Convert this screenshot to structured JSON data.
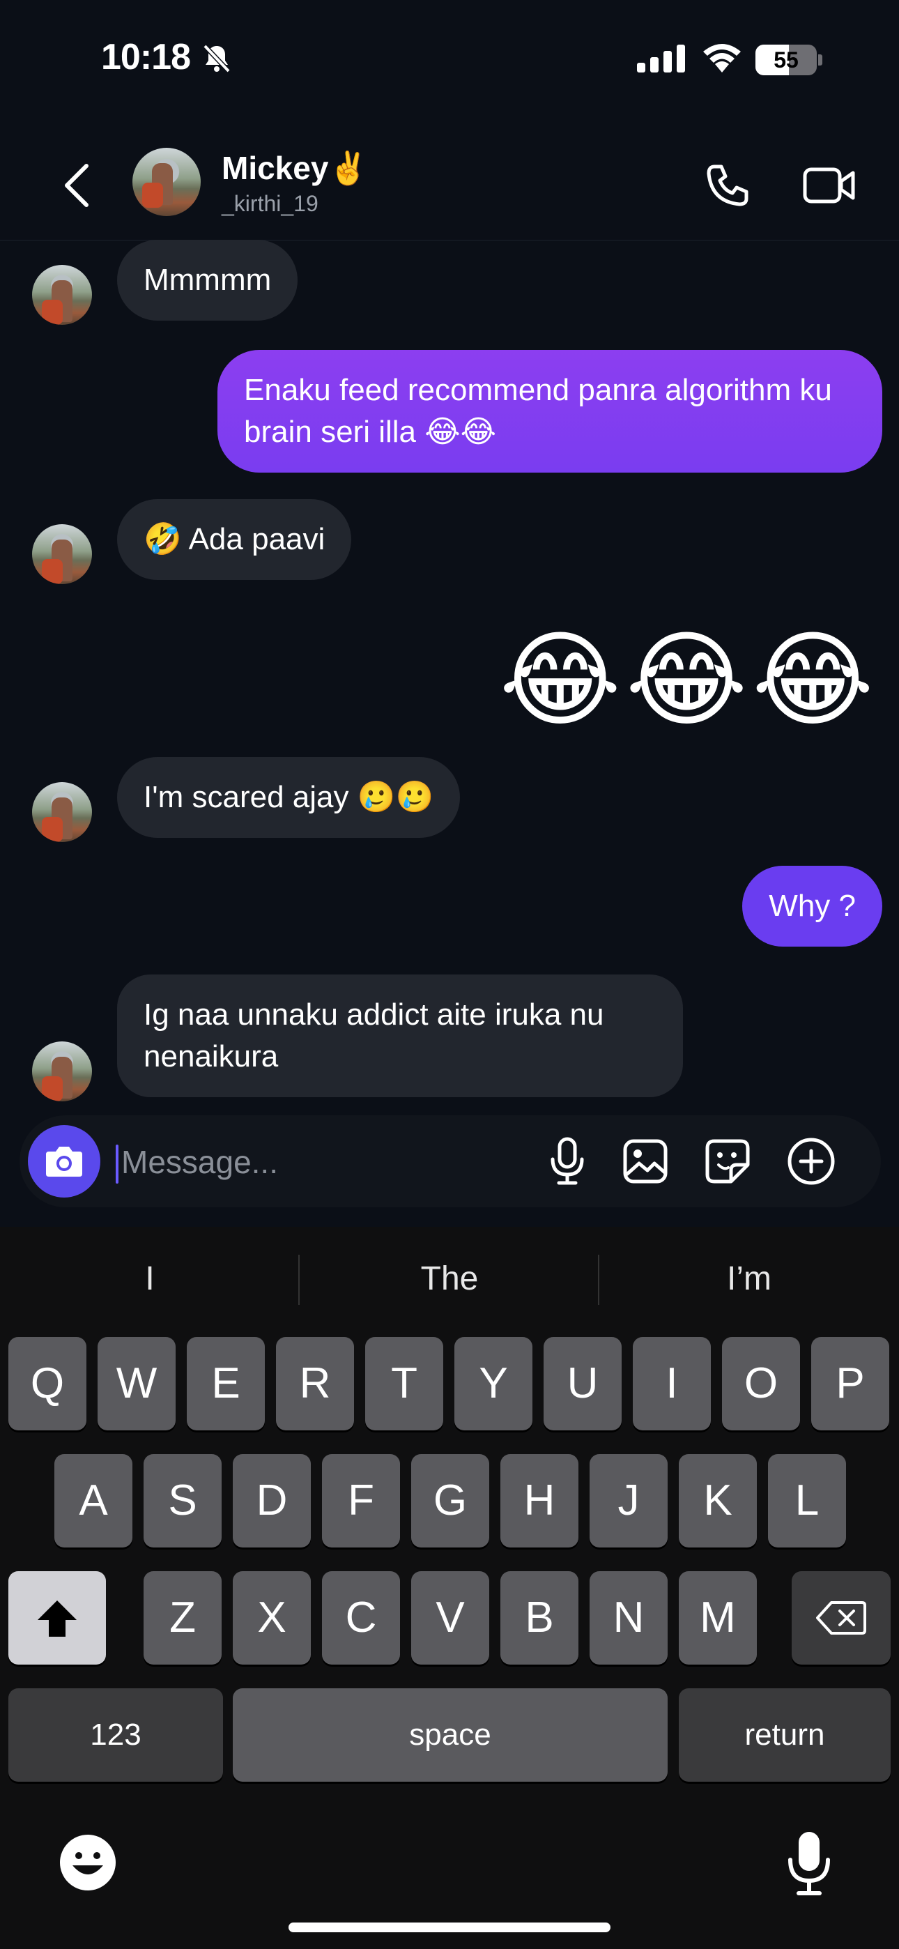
{
  "status_bar": {
    "time": "10:18",
    "battery": "55",
    "battery_level": 0.55,
    "silent": true
  },
  "header": {
    "name": "Mickey✌️",
    "username": "_kirthi_19"
  },
  "messages": [
    {
      "from": "them",
      "text": "Mmmmm"
    },
    {
      "from": "me",
      "text": "Enaku feed recommend panra algorithm ku brain seri illa 😂😂"
    },
    {
      "from": "them",
      "text": "🤣 Ada paavi"
    },
    {
      "from": "me",
      "text": "😂😂😂"
    },
    {
      "from": "them",
      "text": "I'm scared ajay 🥲🥲"
    },
    {
      "from": "me",
      "text": "Why ?"
    },
    {
      "from": "them",
      "text": "Ig naa unnaku addict aite iruka nu nenaikura"
    }
  ],
  "composer": {
    "placeholder": "Message..."
  },
  "keyboard": {
    "suggestions": [
      "I",
      "The",
      "I’m"
    ],
    "row1": [
      "Q",
      "W",
      "E",
      "R",
      "T",
      "Y",
      "U",
      "I",
      "O",
      "P"
    ],
    "row2": [
      "A",
      "S",
      "D",
      "F",
      "G",
      "H",
      "J",
      "K",
      "L"
    ],
    "row3": [
      "Z",
      "X",
      "C",
      "V",
      "B",
      "N",
      "M"
    ],
    "numbers_label": "123",
    "space_label": "space",
    "return_label": "return"
  },
  "colors": {
    "outgoing": "#8c3ef0",
    "incoming": "#22262e",
    "accent": "#5a49ec",
    "background": "#0b0f17"
  }
}
